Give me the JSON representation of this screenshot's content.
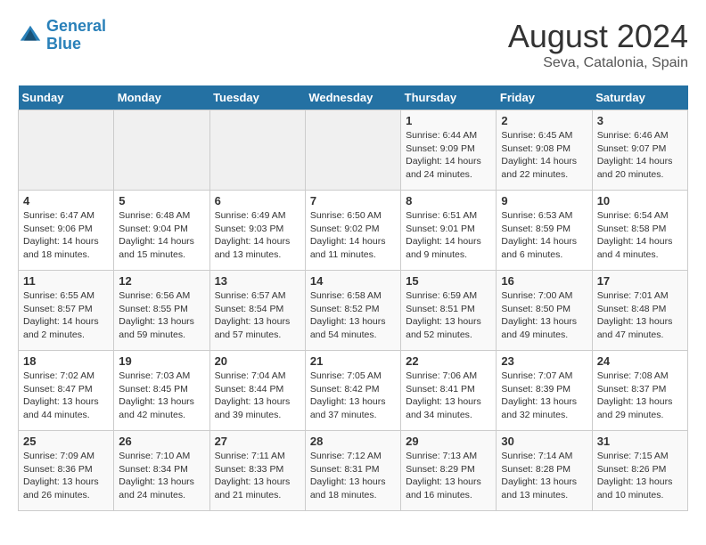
{
  "header": {
    "logo_line1": "General",
    "logo_line2": "Blue",
    "title": "August 2024",
    "subtitle": "Seva, Catalonia, Spain"
  },
  "weekdays": [
    "Sunday",
    "Monday",
    "Tuesday",
    "Wednesday",
    "Thursday",
    "Friday",
    "Saturday"
  ],
  "weeks": [
    [
      {
        "num": "",
        "info": ""
      },
      {
        "num": "",
        "info": ""
      },
      {
        "num": "",
        "info": ""
      },
      {
        "num": "",
        "info": ""
      },
      {
        "num": "1",
        "info": "Sunrise: 6:44 AM\nSunset: 9:09 PM\nDaylight: 14 hours\nand 24 minutes."
      },
      {
        "num": "2",
        "info": "Sunrise: 6:45 AM\nSunset: 9:08 PM\nDaylight: 14 hours\nand 22 minutes."
      },
      {
        "num": "3",
        "info": "Sunrise: 6:46 AM\nSunset: 9:07 PM\nDaylight: 14 hours\nand 20 minutes."
      }
    ],
    [
      {
        "num": "4",
        "info": "Sunrise: 6:47 AM\nSunset: 9:06 PM\nDaylight: 14 hours\nand 18 minutes."
      },
      {
        "num": "5",
        "info": "Sunrise: 6:48 AM\nSunset: 9:04 PM\nDaylight: 14 hours\nand 15 minutes."
      },
      {
        "num": "6",
        "info": "Sunrise: 6:49 AM\nSunset: 9:03 PM\nDaylight: 14 hours\nand 13 minutes."
      },
      {
        "num": "7",
        "info": "Sunrise: 6:50 AM\nSunset: 9:02 PM\nDaylight: 14 hours\nand 11 minutes."
      },
      {
        "num": "8",
        "info": "Sunrise: 6:51 AM\nSunset: 9:01 PM\nDaylight: 14 hours\nand 9 minutes."
      },
      {
        "num": "9",
        "info": "Sunrise: 6:53 AM\nSunset: 8:59 PM\nDaylight: 14 hours\nand 6 minutes."
      },
      {
        "num": "10",
        "info": "Sunrise: 6:54 AM\nSunset: 8:58 PM\nDaylight: 14 hours\nand 4 minutes."
      }
    ],
    [
      {
        "num": "11",
        "info": "Sunrise: 6:55 AM\nSunset: 8:57 PM\nDaylight: 14 hours\nand 2 minutes."
      },
      {
        "num": "12",
        "info": "Sunrise: 6:56 AM\nSunset: 8:55 PM\nDaylight: 13 hours\nand 59 minutes."
      },
      {
        "num": "13",
        "info": "Sunrise: 6:57 AM\nSunset: 8:54 PM\nDaylight: 13 hours\nand 57 minutes."
      },
      {
        "num": "14",
        "info": "Sunrise: 6:58 AM\nSunset: 8:52 PM\nDaylight: 13 hours\nand 54 minutes."
      },
      {
        "num": "15",
        "info": "Sunrise: 6:59 AM\nSunset: 8:51 PM\nDaylight: 13 hours\nand 52 minutes."
      },
      {
        "num": "16",
        "info": "Sunrise: 7:00 AM\nSunset: 8:50 PM\nDaylight: 13 hours\nand 49 minutes."
      },
      {
        "num": "17",
        "info": "Sunrise: 7:01 AM\nSunset: 8:48 PM\nDaylight: 13 hours\nand 47 minutes."
      }
    ],
    [
      {
        "num": "18",
        "info": "Sunrise: 7:02 AM\nSunset: 8:47 PM\nDaylight: 13 hours\nand 44 minutes."
      },
      {
        "num": "19",
        "info": "Sunrise: 7:03 AM\nSunset: 8:45 PM\nDaylight: 13 hours\nand 42 minutes."
      },
      {
        "num": "20",
        "info": "Sunrise: 7:04 AM\nSunset: 8:44 PM\nDaylight: 13 hours\nand 39 minutes."
      },
      {
        "num": "21",
        "info": "Sunrise: 7:05 AM\nSunset: 8:42 PM\nDaylight: 13 hours\nand 37 minutes."
      },
      {
        "num": "22",
        "info": "Sunrise: 7:06 AM\nSunset: 8:41 PM\nDaylight: 13 hours\nand 34 minutes."
      },
      {
        "num": "23",
        "info": "Sunrise: 7:07 AM\nSunset: 8:39 PM\nDaylight: 13 hours\nand 32 minutes."
      },
      {
        "num": "24",
        "info": "Sunrise: 7:08 AM\nSunset: 8:37 PM\nDaylight: 13 hours\nand 29 minutes."
      }
    ],
    [
      {
        "num": "25",
        "info": "Sunrise: 7:09 AM\nSunset: 8:36 PM\nDaylight: 13 hours\nand 26 minutes."
      },
      {
        "num": "26",
        "info": "Sunrise: 7:10 AM\nSunset: 8:34 PM\nDaylight: 13 hours\nand 24 minutes."
      },
      {
        "num": "27",
        "info": "Sunrise: 7:11 AM\nSunset: 8:33 PM\nDaylight: 13 hours\nand 21 minutes."
      },
      {
        "num": "28",
        "info": "Sunrise: 7:12 AM\nSunset: 8:31 PM\nDaylight: 13 hours\nand 18 minutes."
      },
      {
        "num": "29",
        "info": "Sunrise: 7:13 AM\nSunset: 8:29 PM\nDaylight: 13 hours\nand 16 minutes."
      },
      {
        "num": "30",
        "info": "Sunrise: 7:14 AM\nSunset: 8:28 PM\nDaylight: 13 hours\nand 13 minutes."
      },
      {
        "num": "31",
        "info": "Sunrise: 7:15 AM\nSunset: 8:26 PM\nDaylight: 13 hours\nand 10 minutes."
      }
    ]
  ]
}
